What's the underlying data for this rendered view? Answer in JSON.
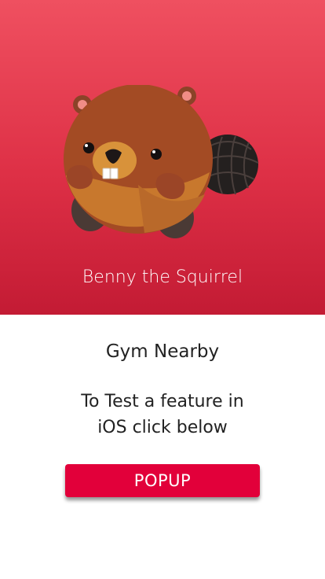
{
  "hero": {
    "mascot_icon": "beaver-mascot-icon",
    "title": "Benny the Squirrel"
  },
  "content": {
    "subtitle": "Gym Nearby",
    "feature_line_1": "To Test a feature in",
    "feature_line_2": "iOS click below"
  },
  "actions": {
    "popup_label": "POPUP"
  },
  "colors": {
    "hero_top": "#ef5060",
    "hero_bottom": "#c31b34",
    "button": "#e2003a",
    "text": "#222222"
  }
}
